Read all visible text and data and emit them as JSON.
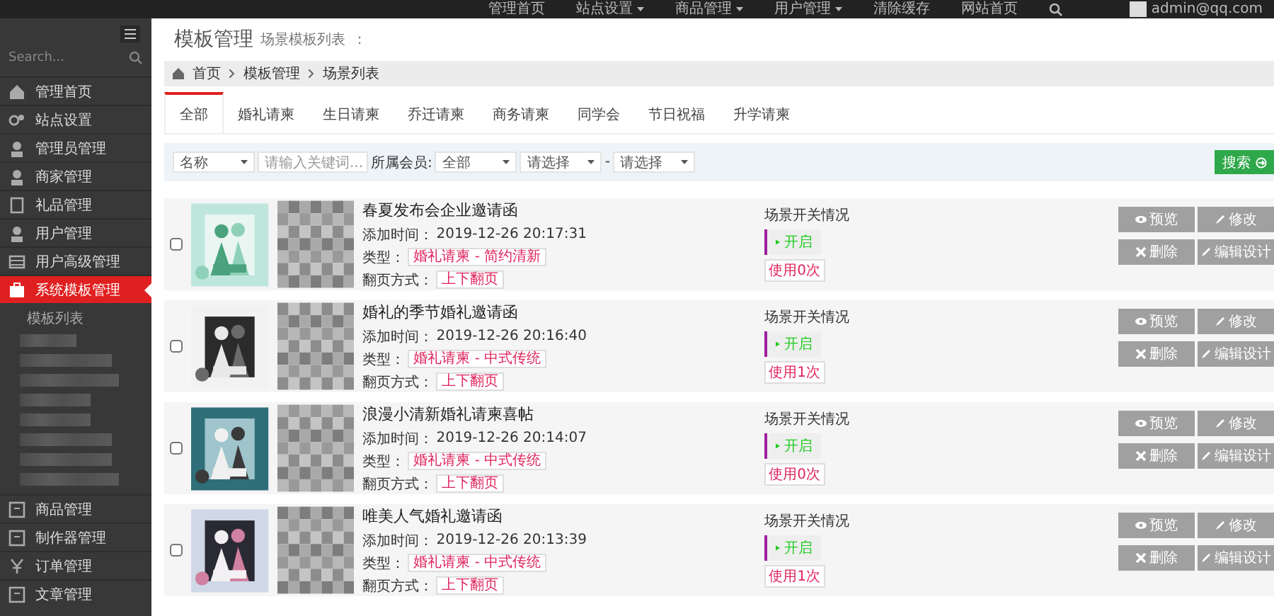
{
  "top_nav": {
    "items": [
      {
        "label": "管理首页",
        "dropdown": false
      },
      {
        "label": "站点设置",
        "dropdown": true
      },
      {
        "label": "商品管理",
        "dropdown": true
      },
      {
        "label": "用户管理",
        "dropdown": true
      },
      {
        "label": "清除缓存",
        "dropdown": false
      },
      {
        "label": "网站首页",
        "dropdown": false
      }
    ],
    "user": "admin@qq.com"
  },
  "sidebar": {
    "search_placeholder": "Search...",
    "items": [
      {
        "label": "管理首页",
        "selected": false
      },
      {
        "label": "站点设置",
        "selected": false
      },
      {
        "label": "管理员管理",
        "selected": false
      },
      {
        "label": "商家管理",
        "selected": false
      },
      {
        "label": "礼品管理",
        "selected": false
      },
      {
        "label": "用户管理",
        "selected": false
      },
      {
        "label": "用户高级管理",
        "selected": false
      },
      {
        "label": "系统模板管理",
        "selected": true,
        "children": [
          {
            "label": "模板列表"
          }
        ]
      },
      {
        "label": "商品管理",
        "selected": false
      },
      {
        "label": "制作器管理",
        "selected": false
      },
      {
        "label": "订单管理",
        "selected": false
      },
      {
        "label": "文章管理",
        "selected": false
      }
    ]
  },
  "page": {
    "title": "模板管理",
    "subtitle": "场景模板列表",
    "suffix": "："
  },
  "breadcrumb": [
    "首页",
    "模板管理",
    "场景列表"
  ],
  "tabs": [
    {
      "label": "全部",
      "selected": true
    },
    {
      "label": "婚礼请柬",
      "selected": false
    },
    {
      "label": "生日请柬",
      "selected": false
    },
    {
      "label": "乔迁请柬",
      "selected": false
    },
    {
      "label": "商务请柬",
      "selected": false
    },
    {
      "label": "同学会",
      "selected": false
    },
    {
      "label": "节日祝福",
      "selected": false
    },
    {
      "label": "升学请柬",
      "selected": false
    }
  ],
  "filter": {
    "field_select": "名称",
    "keyword_placeholder": "请输入关键词...",
    "member_label": "所属会员:",
    "member_select": "全部",
    "select_1": "请选择",
    "separator": "-",
    "select_2": "请选择",
    "search_button": "搜索"
  },
  "rows": [
    {
      "checked": false,
      "title": "春夏发布会企业邀请函",
      "time_label": "添加时间：",
      "time": "2019-12-26 20:17:31",
      "type_label": "类型：",
      "type": "婚礼请柬 - 简约清新",
      "flip_label": "翻页方式：",
      "flip": "上下翻页",
      "status_label": "场景开关情况",
      "toggle": "开启",
      "on": true,
      "usage": "使用0次",
      "buttons": [
        "预览",
        "修改",
        "删除",
        "编辑设计"
      ]
    },
    {
      "checked": false,
      "title": "婚礼的季节婚礼邀请函",
      "time_label": "添加时间：",
      "time": "2019-12-26 20:16:40",
      "type_label": "类型：",
      "type": "婚礼请柬 - 中式传统",
      "flip_label": "翻页方式：",
      "flip": "上下翻页",
      "status_label": "场景开关情况",
      "toggle": "开启",
      "on": true,
      "usage": "使用1次",
      "buttons": [
        "预览",
        "修改",
        "删除",
        "编辑设计"
      ]
    },
    {
      "checked": false,
      "title": "浪漫小清新婚礼请柬喜帖",
      "time_label": "添加时间：",
      "time": "2019-12-26 20:14:07",
      "type_label": "类型：",
      "type": "婚礼请柬 - 中式传统",
      "flip_label": "翻页方式：",
      "flip": "上下翻页",
      "status_label": "场景开关情况",
      "toggle": "开启",
      "on": true,
      "usage": "使用0次",
      "buttons": [
        "预览",
        "修改",
        "删除",
        "编辑设计"
      ]
    },
    {
      "checked": false,
      "title": "唯美人气婚礼邀请函",
      "time_label": "添加时间：",
      "time": "2019-12-26 20:13:39",
      "type_label": "类型：",
      "type": "婚礼请柬 - 中式传统",
      "flip_label": "翻页方式：",
      "flip": "上下翻页",
      "status_label": "场景开关情况",
      "toggle": "开启",
      "on": true,
      "usage": "使用1次",
      "buttons": [
        "预览",
        "修改",
        "删除",
        "编辑设计"
      ]
    }
  ]
}
